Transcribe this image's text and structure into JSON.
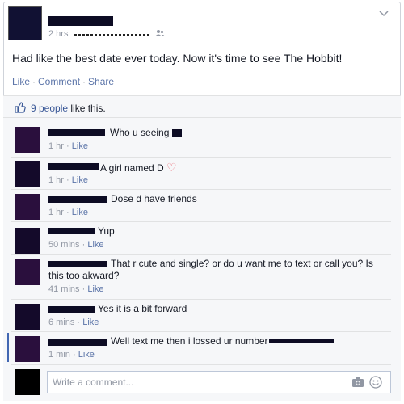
{
  "post": {
    "time": "2 hrs",
    "status": "Had like the best date ever today. Now it's time to see The Hobbit!",
    "actions": {
      "like": "Like",
      "comment": "Comment",
      "share": "Share"
    },
    "likes_count": "9 people",
    "likes_suffix": " like this."
  },
  "comments": [
    {
      "text": "Who u seeing",
      "time": "1 hr",
      "like": "Like"
    },
    {
      "text": "A girl named D",
      "time": "1 hr",
      "like": "Like"
    },
    {
      "text": "Dose d have friends",
      "time": "1 hr",
      "like": "Like"
    },
    {
      "text": "Yup",
      "time": "50 mins",
      "like": "Like"
    },
    {
      "text": "That r cute and single? or do u want me to text or call you? Is",
      "text2": "this too akward?",
      "time": "41 mins",
      "like": "Like"
    },
    {
      "text": "Yes it is a bit forward",
      "time": "6 mins",
      "like": "Like"
    },
    {
      "text": "Well text me then i lossed ur number",
      "time": "1 min",
      "like": "Like"
    }
  ],
  "composer": {
    "placeholder": "Write a comment..."
  },
  "separator": "·",
  "colors": {
    "link": "#5b74a8",
    "accent": "#3b5998",
    "redaction": "#0d0c24"
  },
  "icons": [
    "chevron-down-icon",
    "friends-audience-icon",
    "thumbs-up-icon",
    "heart-emoji-icon",
    "camera-icon",
    "smiley-icon"
  ]
}
